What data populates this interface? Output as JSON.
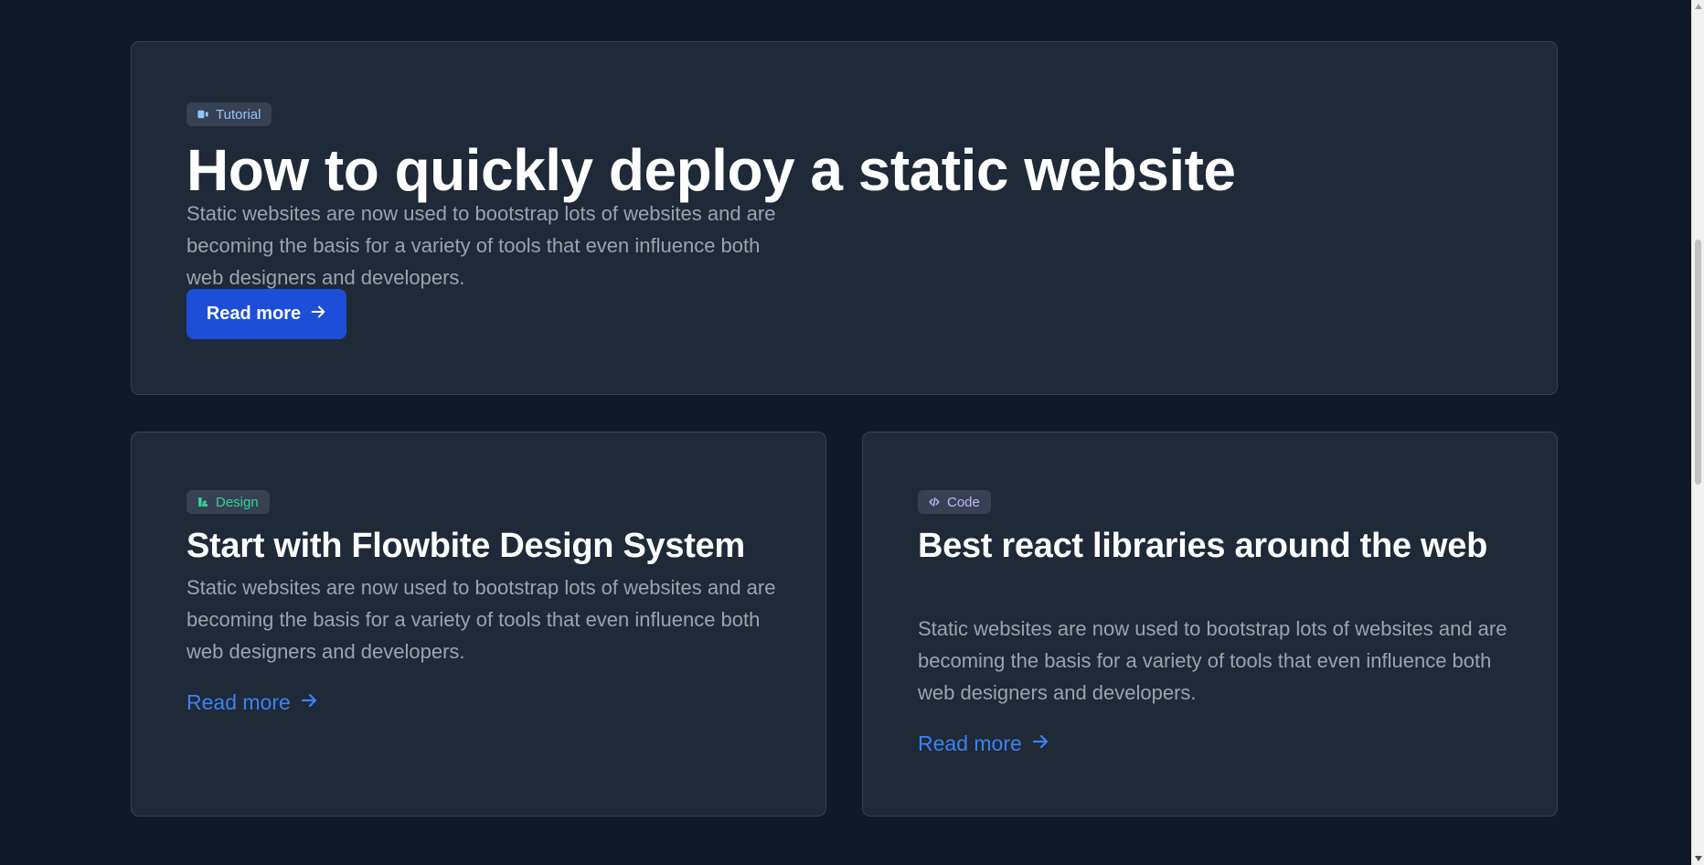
{
  "hero": {
    "badge": {
      "label": "Tutorial",
      "icon": "video-camera-icon",
      "color": "#93c5fd"
    },
    "title": "How to quickly deploy a static website",
    "description": "Static websites are now used to bootstrap lots of websites and are becoming the basis for a variety of tools that even influence both web designers and developers.",
    "button_label": "Read more",
    "button_color": "#1d4ed8"
  },
  "cards": [
    {
      "badge": {
        "label": "Design",
        "icon": "design-icon",
        "color": "#34d399"
      },
      "title": "Start with Flowbite Design System",
      "description": "Static websites are now used to bootstrap lots of websites and are becoming the basis for a variety of tools that even influence both web designers and developers.",
      "link_label": "Read more"
    },
    {
      "badge": {
        "label": "Code",
        "icon": "code-icon",
        "color": "#c4b5fd"
      },
      "title": "Best react libraries around the web",
      "description": "Static websites are now used to bootstrap lots of websites and are becoming the basis for a variety of tools that even influence both web designers and developers.",
      "link_label": "Read more"
    }
  ],
  "theme": {
    "background": "#111827",
    "card_background": "#1f2937",
    "link_color": "#3b82f6"
  }
}
